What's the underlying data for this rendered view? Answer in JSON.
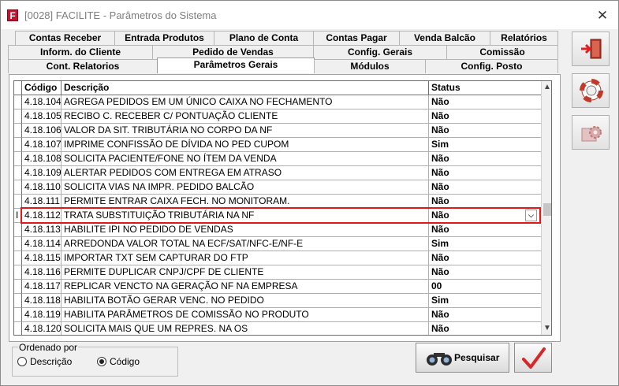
{
  "window": {
    "title": "[0028] FACILITE - Parâmetros do Sistema",
    "app_icon_letter": "F",
    "close_glyph": "✕"
  },
  "tabs": {
    "row1": [
      "Contas Receber",
      "Entrada Produtos",
      "Plano de Conta",
      "Contas Pagar",
      "Venda Balcão",
      "Relatórios"
    ],
    "row2": [
      "Inform. do Cliente",
      "Pedido de Vendas",
      "Config. Gerais",
      "Comissão"
    ],
    "row3": [
      "Cont. Relatorios",
      "Parâmetros Gerais",
      "Módulos",
      "Config. Posto"
    ],
    "active": "Parâmetros Gerais"
  },
  "grid": {
    "columns": [
      "Código",
      "Descrição",
      "Status"
    ],
    "rows": [
      {
        "code": "4.18.104",
        "desc": "AGREGA PEDIDOS EM UM ÚNICO CAIXA NO FECHAMENTO",
        "status": "Não"
      },
      {
        "code": "4.18.105",
        "desc": "RECIBO C. RECEBER C/ PONTUAÇÃO CLIENTE",
        "status": "Não"
      },
      {
        "code": "4.18.106",
        "desc": "VALOR DA SIT. TRIBUTÁRIA NO CORPO DA NF",
        "status": "Não"
      },
      {
        "code": "4.18.107",
        "desc": "IMPRIME CONFISSÃO DE DÍVIDA NO PED CUPOM",
        "status": "Sim"
      },
      {
        "code": "4.18.108",
        "desc": "SOLICITA PACIENTE/FONE NO ÍTEM DA VENDA",
        "status": "Não"
      },
      {
        "code": "4.18.109",
        "desc": "ALERTAR PEDIDOS COM ENTREGA EM ATRASO",
        "status": "Não"
      },
      {
        "code": "4.18.110",
        "desc": "SOLICITA VIAS NA IMPR. PEDIDO BALCÃO",
        "status": "Não"
      },
      {
        "code": "4.18.111",
        "desc": "PERMITE ENTRAR CAIXA FECH. NO MONITORAM.",
        "status": "Não"
      },
      {
        "code": "4.18.112",
        "desc": "TRATA SUBSTITUIÇÃO TRIBUTÁRIA NA NF",
        "status": "Não"
      },
      {
        "code": "4.18.113",
        "desc": "HABILITE IPI NO PEDIDO DE VENDAS",
        "status": "Não"
      },
      {
        "code": "4.18.114",
        "desc": "ARREDONDA VALOR TOTAL NA ECF/SAT/NFC-E/NF-E",
        "status": "Sim"
      },
      {
        "code": "4.18.115",
        "desc": "IMPORTAR TXT SEM CAPTURAR DO FTP",
        "status": "Não"
      },
      {
        "code": "4.18.116",
        "desc": "PERMITE DUPLICAR CNPJ/CPF DE CLIENTE",
        "status": "Não"
      },
      {
        "code": "4.18.117",
        "desc": "REPLICAR VENCTO NA GERAÇÃO NF NA EMPRESA",
        "status": "00"
      },
      {
        "code": "4.18.118",
        "desc": "HABILITA BOTÃO GERAR VENC. NO PEDIDO",
        "status": "Sim"
      },
      {
        "code": "4.18.119",
        "desc": "HABILITA PARÂMETROS DE COMISSÃO NO PRODUTO",
        "status": "Não"
      },
      {
        "code": "4.18.120",
        "desc": "SOLICITA MAIS QUE UM REPRES. NA OS",
        "status": "Não"
      }
    ],
    "selected_index": 8,
    "row_cursor_glyph": "I",
    "scroll_up_glyph": "▲",
    "scroll_down_glyph": "▼",
    "dropdown_glyph": "⌵"
  },
  "order": {
    "legend": "Ordenado por",
    "options": [
      "Descrição",
      "Código"
    ],
    "selected": "Código"
  },
  "buttons": {
    "search_label": "Pesquisar",
    "confirm_icon": "checkmark-icon",
    "exit_icon": "exit-door-icon",
    "help_icon": "lifebuoy-icon",
    "settings_icon": "gear-icon"
  },
  "colors": {
    "highlight_border": "#e01818",
    "exit_arrow": "#e02020",
    "check": "#d42a2a"
  }
}
